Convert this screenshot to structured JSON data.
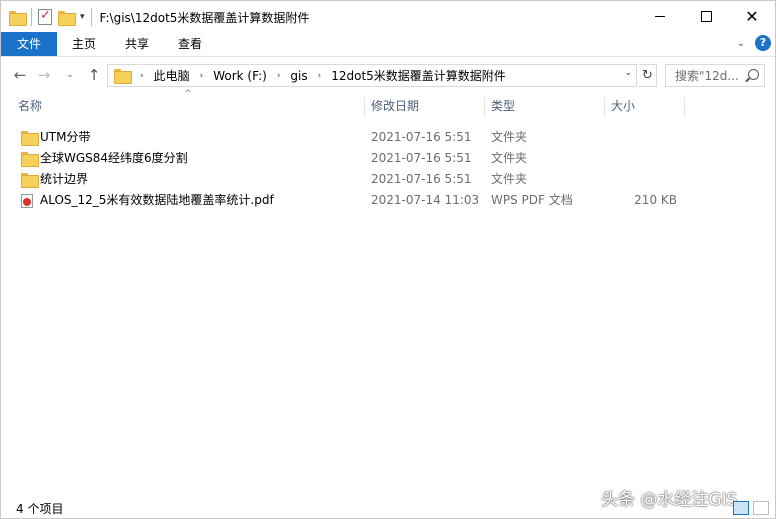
{
  "window": {
    "title": "F:\\gis\\12dot5米数据覆盖计算数据附件",
    "controls": {
      "minimize": "",
      "maximize": "",
      "close": "✕"
    }
  },
  "quick_access": {
    "icons": [
      "folder-icon",
      "properties-icon",
      "new-folder-icon"
    ],
    "dropdown": "▾"
  },
  "ribbon": {
    "tabs": [
      {
        "label": "文件",
        "active": true
      },
      {
        "label": "主页"
      },
      {
        "label": "共享"
      },
      {
        "label": "查看"
      }
    ],
    "expand": "⌄",
    "help": "?"
  },
  "nav": {
    "back": "←",
    "forward": "→",
    "recent": "⌄",
    "up": "↑",
    "breadcrumb": [
      "此电脑",
      "Work (F:)",
      "gis",
      "12dot5米数据覆盖计算数据附件"
    ],
    "separator": "›",
    "refresh": "↻",
    "search_placeholder": "搜索\"12d..."
  },
  "columns": {
    "name": "名称",
    "date": "修改日期",
    "type": "类型",
    "size": "大小",
    "sort_indicator": "^"
  },
  "files": [
    {
      "name": "UTM分带",
      "date": "2021-07-16 5:51",
      "type": "文件夹",
      "size": "",
      "icon": "folder-icon"
    },
    {
      "name": "全球WGS84经纬度6度分割",
      "date": "2021-07-16 5:51",
      "type": "文件夹",
      "size": "",
      "icon": "folder-icon"
    },
    {
      "name": "统计边界",
      "date": "2021-07-16 5:51",
      "type": "文件夹",
      "size": "",
      "icon": "folder-icon"
    },
    {
      "name": "ALOS_12_5米有效数据陆地覆盖率统计.pdf",
      "date": "2021-07-14 11:03",
      "type": "WPS PDF 文档",
      "size": "210 KB",
      "icon": "pdf-icon"
    }
  ],
  "status": {
    "count": "4 个项目",
    "watermark": "头条 @水经注GIS"
  },
  "colors": {
    "accent": "#1a73c9",
    "folder": "#f7cf5b",
    "header_text": "#4c607a",
    "secondary_text": "#6d6d6d"
  }
}
